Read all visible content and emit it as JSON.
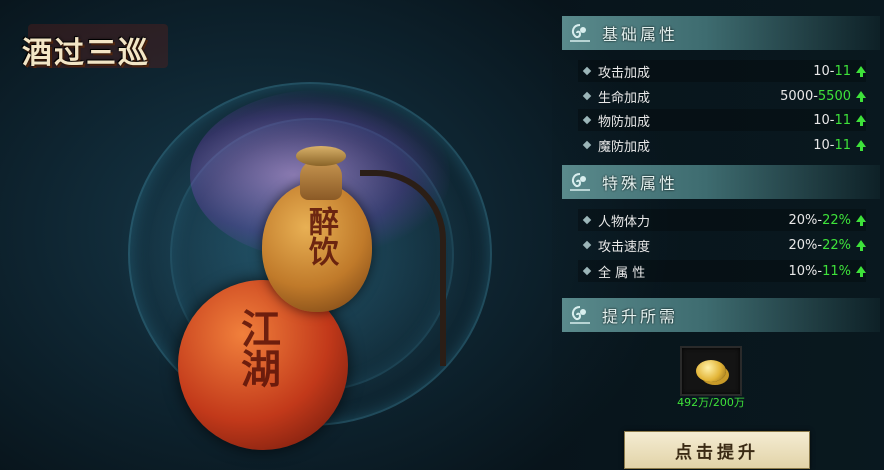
{
  "title": "酒过三巡",
  "sections": [
    {
      "title": "基础属性",
      "icon": "orb-icon"
    },
    {
      "title": "特殊属性",
      "icon": "orb-icon"
    },
    {
      "title": "提升所需",
      "icon": "orb-icon"
    }
  ],
  "basic_attrs": [
    {
      "label": "攻击加成",
      "old": "10-",
      "new": "11"
    },
    {
      "label": "生命加成",
      "old": "5000-",
      "new": "5500"
    },
    {
      "label": "物防加成",
      "old": "10-",
      "new": "11"
    },
    {
      "label": "魔防加成",
      "old": "10-",
      "new": "11"
    }
  ],
  "special_attrs": [
    {
      "label": "人物体力",
      "old": "20%-",
      "new": "22%"
    },
    {
      "label": "攻击速度",
      "old": "20%-",
      "new": "22%"
    },
    {
      "label": "全 属 性",
      "old": "10%-",
      "new": "11%"
    }
  ],
  "requirement": {
    "item_icon": "gold-coins-icon",
    "count": "492万/200万"
  },
  "upgrade_button": "点击提升",
  "gourd_text": {
    "top": "醉饮",
    "bottom": "江湖"
  },
  "colors": {
    "increase": "#3ee23a",
    "button": "#f4ecd2"
  }
}
